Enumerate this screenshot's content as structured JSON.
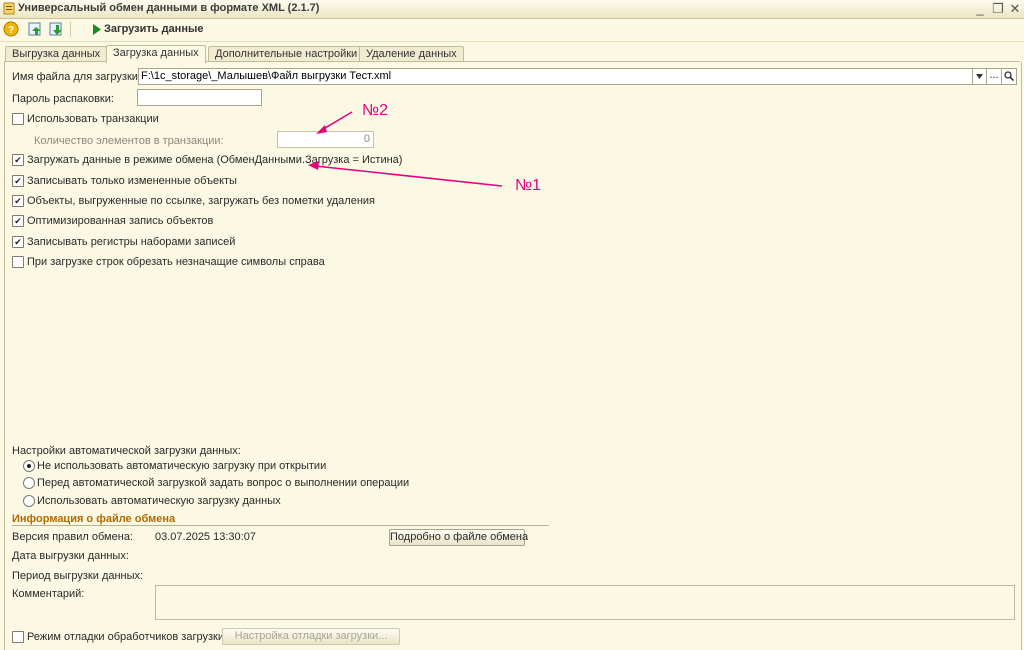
{
  "window": {
    "title": "Универсальный обмен данными в формате XML (2.1.7)",
    "minimize": "_",
    "restore": "❐",
    "close": "✕"
  },
  "toolbar": {
    "load_label": "Загрузить данные"
  },
  "tabs": [
    {
      "label": "Выгрузка данных"
    },
    {
      "label": "Загрузка данных"
    },
    {
      "label": "Дополнительные настройки"
    },
    {
      "label": "Удаление данных"
    }
  ],
  "form": {
    "file_label": "Имя файла для загрузки:",
    "file_value": "F:\\1c_storage\\_Малышев\\Файл выгрузки Тест.xml",
    "file_dots": "...",
    "password_label": "Пароль распаковки:",
    "use_transactions": "Использовать транзакции",
    "tx_count_label": "Количество элементов в транзакции:",
    "tx_count_value": "0",
    "check_exchange_mode": "Загружать данные в режиме обмена (ОбменДанными.Загрузка = Истина)",
    "check_changed_only": "Записывать только измененные объекты",
    "check_by_ref": "Объекты, выгруженные по ссылке, загружать без пометки удаления",
    "check_optimized": "Оптимизированная запись объектов",
    "check_registers": "Записывать регистры наборами записей",
    "check_trim": "При загрузке строк обрезать незначащие символы справа",
    "check_mark": "✔"
  },
  "auto_load": {
    "label": "Настройки автоматической загрузки данных:",
    "options": [
      "Не использовать автоматическую загрузку при открытии",
      "Перед автоматической загрузкой задать вопрос о выполнении операции",
      "Использовать автоматическую загрузку данных"
    ],
    "selected_index": 0
  },
  "info": {
    "header": "Информация о файле обмена",
    "rules_version_label": "Версия правил обмена:",
    "rules_version_value": "03.07.2025 13:30:07",
    "details_button": "Подробно о файле обмена",
    "export_date_label": "Дата выгрузки данных:",
    "export_period_label": "Период выгрузки данных:",
    "comment_label": "Комментарий:"
  },
  "debug": {
    "checkbox_label": "Режим отладки обработчиков загрузки",
    "settings_button": "Настройка отладки загрузки..."
  },
  "annotations": {
    "n1": "№1",
    "n2": "№2"
  },
  "colors": {
    "annotation": "#e6007e",
    "section_header": "#b06a00",
    "background": "#fbf8e4"
  }
}
